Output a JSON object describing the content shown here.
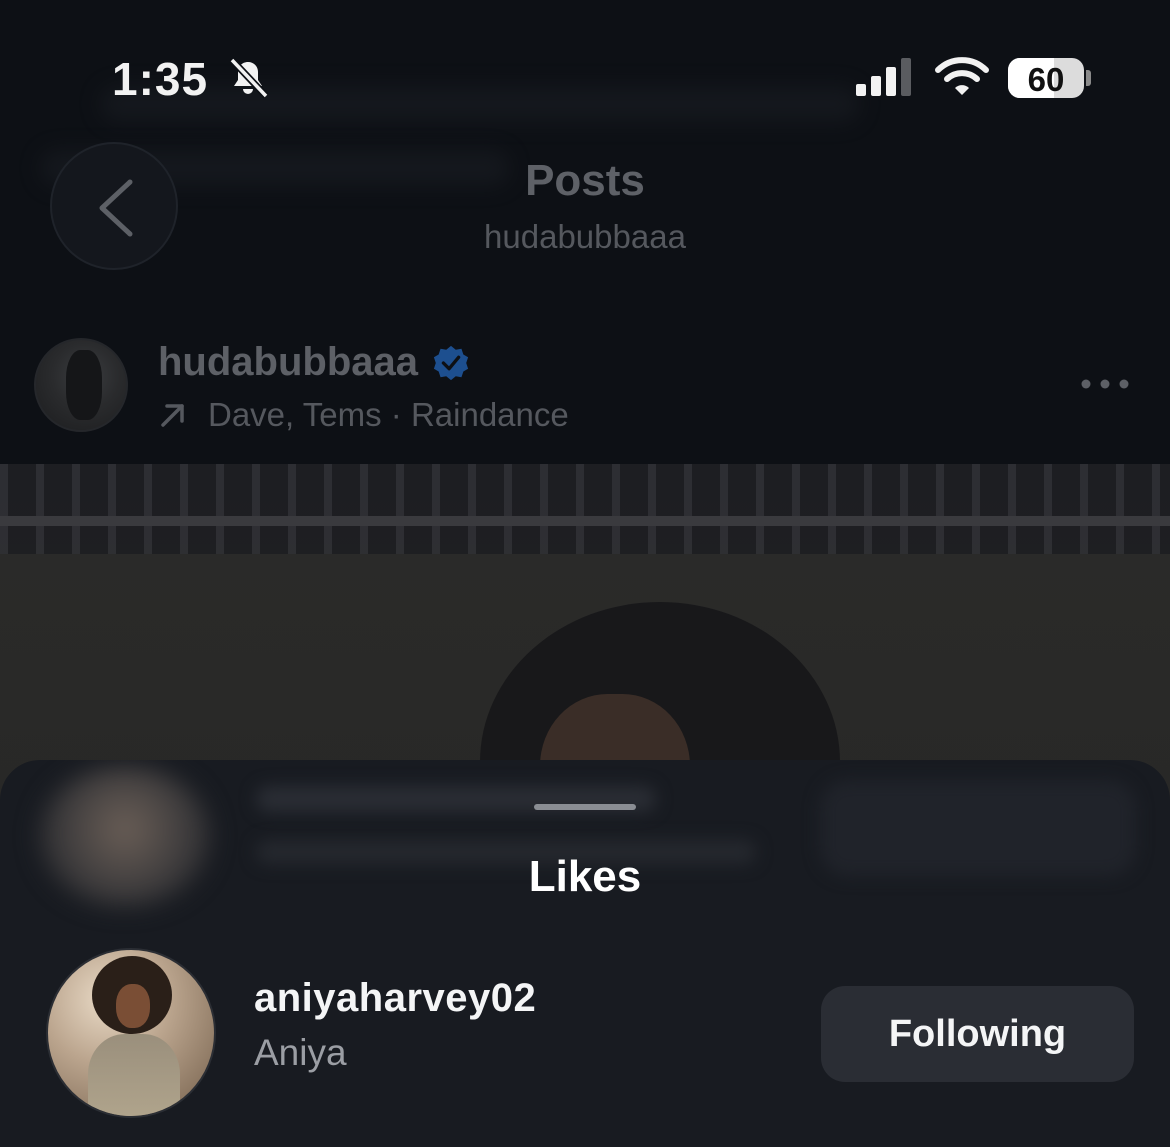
{
  "status_bar": {
    "time": "1:35",
    "battery": "60",
    "battery_level": 0.6
  },
  "header": {
    "title": "Posts",
    "subtitle": "hudabubbaaa"
  },
  "post": {
    "username": "hudabubbaaa",
    "verified": true,
    "music": "Dave, Tems · Raindance"
  },
  "likes_sheet": {
    "title": "Likes",
    "rows": [
      {
        "username": "aniyaharvey02",
        "full_name": "Aniya",
        "button_label": "Following"
      }
    ]
  },
  "colors": {
    "background": "#0d1015",
    "sheet": "#181b21",
    "button": "#2a2d34",
    "verified": "#1d4f8f"
  },
  "icons": {
    "back": "chevron-left-icon",
    "mute": "bell-slash-icon",
    "signal": "cellular-signal-icon",
    "wifi": "wifi-icon",
    "verified": "verified-badge-icon",
    "music": "arrow-up-right-icon",
    "more": "more-horizontal-icon"
  }
}
